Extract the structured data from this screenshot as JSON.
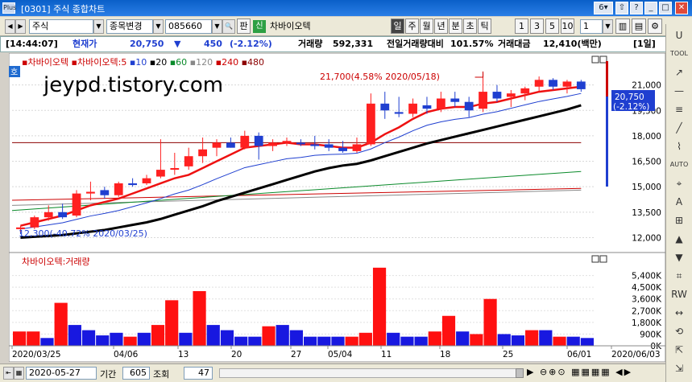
{
  "window": {
    "logo": "Plus",
    "title": "[0301] 주식 종합차트",
    "page_no": "6",
    "title_buttons": [
      "▼",
      "⇧",
      "?",
      "_",
      "□",
      "✕"
    ]
  },
  "toolbar": {
    "market": "주식",
    "change_label": "종목변경",
    "code": "085660",
    "pan_label": "판",
    "badge": "신",
    "stock_name": "차바이오텍",
    "periods": [
      "일",
      "주",
      "월",
      "년",
      "분",
      "초",
      "틱"
    ],
    "selected_period": "일",
    "quick_numbers": [
      "1",
      "3",
      "5",
      "10"
    ],
    "interval": "1"
  },
  "status": {
    "time": "[14:44:07]",
    "price_label": "현재가",
    "price": "20,750",
    "change_arrow": "▼",
    "change": "450",
    "change_pct": "(-2.12%)",
    "volume_label": "거래량",
    "volume": "592,331",
    "prev_ratio_label": "전일거래량대비",
    "prev_ratio": "101.57%",
    "amount_label": "거래대금",
    "amount": "12,410(백만)",
    "period_tag": "[1일]"
  },
  "price_pane": {
    "legend": [
      {
        "text": "차바이오텍",
        "color": "#cc0000"
      },
      {
        "text": "차바이오텍:5",
        "color": "#cc0000"
      },
      {
        "text": "10",
        "color": "#1f3fd0"
      },
      {
        "text": "20",
        "color": "#000000"
      },
      {
        "text": "60",
        "color": "#0a8a2a"
      },
      {
        "text": "120",
        "color": "#888888"
      },
      {
        "text": "240",
        "color": "#cc0000"
      },
      {
        "text": "480",
        "color": "#8b0000"
      }
    ],
    "ho_label": "호",
    "watermark": "jeypd.tistory.com",
    "high_annotation": "21,700(4.58% 2020/05/18)",
    "low_annotation": "12,300(-40.72% 2020/03/25)",
    "current_price_tag": "20,750",
    "current_change_tag": "(-2.12%)"
  },
  "volume_pane": {
    "legend": "차바이오텍:거래량",
    "y_ticks": [
      "5,400K",
      "4,500K",
      "3,600K",
      "2,700K",
      "1,800K",
      "900K",
      "0K"
    ]
  },
  "x_labels": [
    "2020/03/25",
    "04/06",
    "13",
    "20",
    "27",
    "05/04",
    "11",
    "18",
    "25",
    "06/01",
    "2020/06/03"
  ],
  "bottom": {
    "date": "2020-05-27",
    "period_label": "기간",
    "period_value": "605",
    "view_label": "조회",
    "view_value": "47"
  },
  "right_toolbar": [
    "U",
    "TOOL",
    "↗",
    "—",
    "≡",
    "╱",
    "⌇",
    "AUTO",
    "⌖",
    "A",
    "⊞",
    "▲",
    "▼",
    "⌗",
    "RW",
    "↔",
    "⟲",
    "⇱",
    "⇲"
  ],
  "chart_data": [
    {
      "type": "candlestick",
      "title": "차바이오텍",
      "x_start": "2020/03/25",
      "x_end": "2020/06/03",
      "ylim": [
        11500,
        22500
      ],
      "y_ticks": [
        12000,
        13500,
        15000,
        16500,
        18000,
        19500,
        21000
      ],
      "ohlc": [
        [
          12500,
          12700,
          12300,
          12600
        ],
        [
          12600,
          13300,
          12500,
          13200
        ],
        [
          13200,
          13900,
          13000,
          13500
        ],
        [
          13500,
          14000,
          13100,
          13200
        ],
        [
          13300,
          14800,
          13200,
          14600
        ],
        [
          14600,
          15300,
          14200,
          14700
        ],
        [
          14800,
          15000,
          14300,
          14500
        ],
        [
          14500,
          15300,
          14400,
          15200
        ],
        [
          15200,
          15500,
          15000,
          15100
        ],
        [
          15200,
          15700,
          15100,
          15500
        ],
        [
          15600,
          17800,
          15500,
          16000
        ],
        [
          16000,
          17000,
          15700,
          16100
        ],
        [
          16200,
          17300,
          16000,
          16800
        ],
        [
          16800,
          17900,
          16400,
          17200
        ],
        [
          17300,
          17800,
          16800,
          17600
        ],
        [
          17600,
          17900,
          17300,
          17300
        ],
        [
          17300,
          18300,
          17200,
          18000
        ],
        [
          18000,
          18200,
          16600,
          17400
        ],
        [
          17400,
          17800,
          17100,
          17600
        ],
        [
          17600,
          17900,
          17400,
          17700
        ],
        [
          17600,
          17800,
          17400,
          17500
        ],
        [
          17500,
          18000,
          17200,
          17400
        ],
        [
          17500,
          17800,
          17100,
          17300
        ],
        [
          17300,
          17700,
          17000,
          17100
        ],
        [
          17100,
          17900,
          17000,
          17500
        ],
        [
          17500,
          20500,
          17400,
          19900
        ],
        [
          19900,
          20600,
          19000,
          19500
        ],
        [
          19400,
          20300,
          19100,
          19300
        ],
        [
          19300,
          20200,
          19100,
          19900
        ],
        [
          19800,
          20300,
          19300,
          19600
        ],
        [
          19600,
          20600,
          19400,
          20200
        ],
        [
          20200,
          20600,
          19700,
          20000
        ],
        [
          20000,
          20300,
          19100,
          19500
        ],
        [
          19600,
          21700,
          19400,
          20600
        ],
        [
          20600,
          21000,
          20000,
          20200
        ],
        [
          20300,
          20700,
          19700,
          20500
        ],
        [
          20500,
          20900,
          20100,
          20800
        ],
        [
          20900,
          21500,
          20600,
          21300
        ],
        [
          21300,
          21400,
          20700,
          20900
        ],
        [
          20900,
          21300,
          20500,
          21200
        ],
        [
          21200,
          21300,
          20600,
          20750
        ]
      ],
      "ma5": [
        12700,
        12900,
        13100,
        13300,
        13600,
        13900,
        14100,
        14300,
        14600,
        14900,
        15200,
        15500,
        15700,
        16100,
        16500,
        16900,
        17300,
        17400,
        17500,
        17600,
        17500,
        17500,
        17400,
        17300,
        17300,
        17600,
        18100,
        18500,
        19000,
        19400,
        19600,
        19700,
        19700,
        19900,
        20000,
        20200,
        20400,
        20600,
        20700,
        20800,
        20900
      ],
      "ma20": [
        12000,
        12050,
        12100,
        12150,
        12250,
        12350,
        12450,
        12600,
        12750,
        12900,
        13100,
        13350,
        13600,
        13850,
        14150,
        14400,
        14650,
        14900,
        15150,
        15400,
        15650,
        15900,
        16100,
        16250,
        16350,
        16550,
        16800,
        17050,
        17300,
        17550,
        17750,
        17950,
        18150,
        18350,
        18550,
        18750,
        18950,
        19150,
        19350,
        19550,
        19800
      ]
    },
    {
      "type": "bar",
      "title": "차바이오텍:거래량",
      "unit": "K",
      "ylim": [
        0,
        6300
      ],
      "values": [
        1100,
        1100,
        600,
        3300,
        1600,
        1200,
        800,
        1000,
        700,
        1000,
        1600,
        3500,
        1000,
        4200,
        1600,
        1200,
        700,
        700,
        1500,
        1600,
        1200,
        700,
        700,
        700,
        700,
        1000,
        6000,
        1000,
        700,
        700,
        1100,
        2300,
        1100,
        900,
        3600,
        900,
        800,
        1200,
        1200,
        700,
        700,
        600
      ],
      "colors": [
        "up",
        "up",
        "down",
        "up",
        "down",
        "down",
        "down",
        "down",
        "up",
        "down",
        "up",
        "up",
        "down",
        "up",
        "down",
        "down",
        "down",
        "down",
        "up",
        "down",
        "down",
        "down",
        "down",
        "down",
        "up",
        "up",
        "up",
        "down",
        "down",
        "down",
        "up",
        "up",
        "down",
        "up",
        "up",
        "down",
        "down",
        "up",
        "down",
        "up",
        "down",
        "down"
      ]
    }
  ]
}
